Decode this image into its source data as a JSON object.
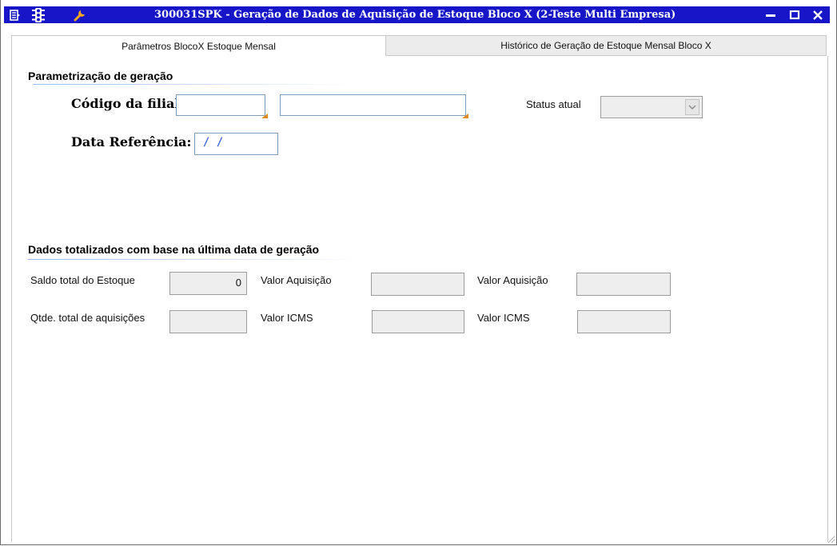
{
  "window": {
    "title": "300031SPK - Geração de Dados de Aquisição de Estoque Bloco X (2-Teste Multi Empresa)",
    "colors": {
      "titlebar": "#1616c8",
      "accent_line": "#9bb8f0",
      "field_border": "#7f9db9",
      "date_text": "#2850d8"
    },
    "icons": [
      "menu-icon",
      "traffic-light-icon",
      "wrench-icon",
      "minimize-icon",
      "maximize-icon",
      "close-icon"
    ]
  },
  "tabs": [
    {
      "label": "Parâmetros BlocoX Estoque Mensal",
      "active": true
    },
    {
      "label": "Histórico de Geração de Estoque Mensal Bloco X",
      "active": false
    }
  ],
  "params": {
    "section_title": "Parametrização de geração",
    "filial_label": "Código da filial:",
    "filial_code_value": "",
    "filial_name_value": "",
    "status_label": "Status atual",
    "status_value": "",
    "data_ref_label": "Data Referência:",
    "data_ref_value": " / /"
  },
  "totals": {
    "section_title": "Dados totalizados com base na última data de geração",
    "saldo_label": "Saldo total do Estoque",
    "saldo_value": "0",
    "qtde_label": "Qtde. total de aquisições",
    "qtde_value": "",
    "valor_aquisicao_label_1": "Valor Aquisição",
    "valor_aquisicao_value_1": "",
    "valor_icms_label_1": "Valor ICMS",
    "valor_icms_value_1": "",
    "valor_aquisicao_label_2": "Valor Aquisição",
    "valor_aquisicao_value_2": "",
    "valor_icms_label_2": "Valor ICMS",
    "valor_icms_value_2": ""
  }
}
